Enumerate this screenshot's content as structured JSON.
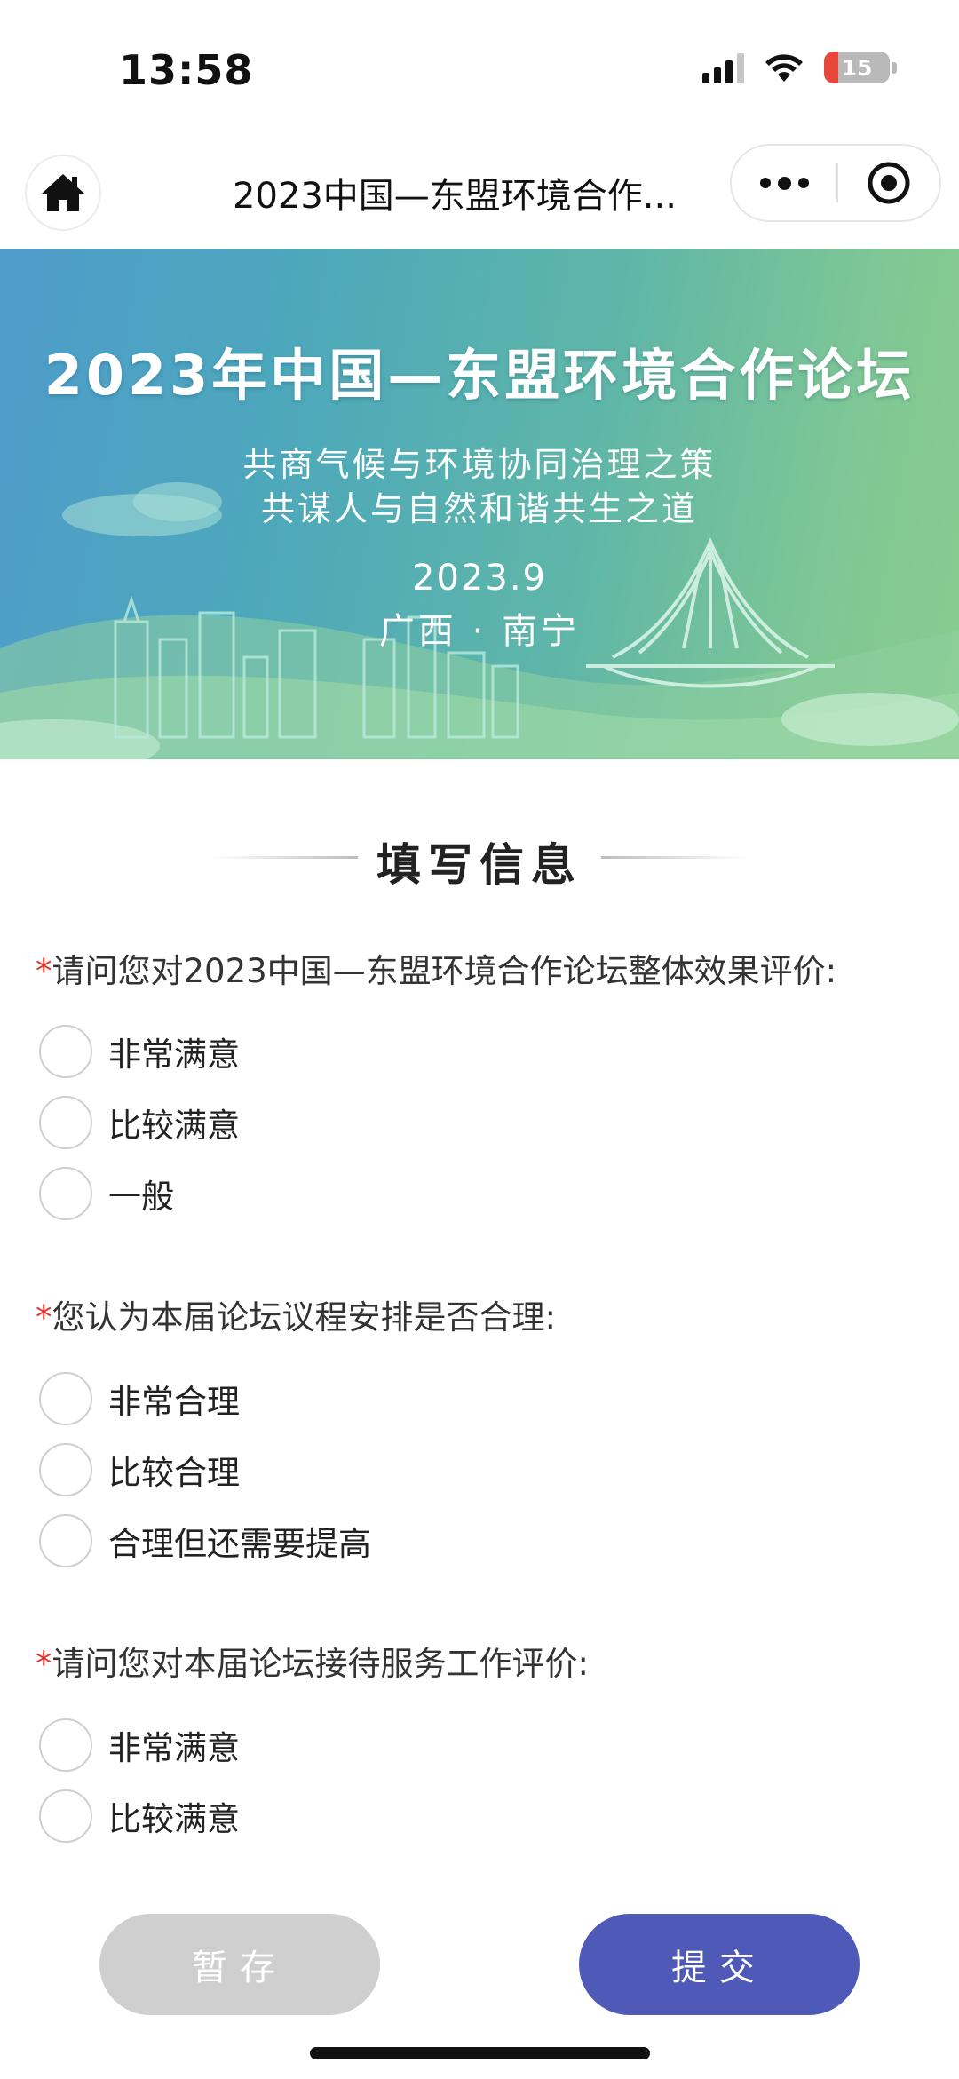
{
  "status_bar": {
    "time": "13:58",
    "battery_level": "15",
    "icons": [
      "signal-icon",
      "wifi-icon",
      "battery-charging-icon"
    ]
  },
  "nav": {
    "title": "2023中国—东盟环境合作...",
    "icons": [
      "home-icon",
      "more-icon",
      "close-mini-program-icon"
    ]
  },
  "banner": {
    "title": "2023年中国—东盟环境合作论坛",
    "subtitle_line1": "共商气候与环境协同治理之策",
    "subtitle_line2": "共谋人与自然和谐共生之道",
    "date": "2023.9",
    "place": "广西 · 南宁"
  },
  "form": {
    "heading": "填写信息",
    "required_mark": "*",
    "questions": [
      {
        "label": "请问您对2023中国—东盟环境合作论坛整体效果评价:",
        "options": [
          "非常满意",
          "比较满意",
          "一般"
        ]
      },
      {
        "label": "您认为本届论坛议程安排是否合理:",
        "options": [
          "非常合理",
          "比较合理",
          "合理但还需要提高"
        ]
      },
      {
        "label": "请问您对本届论坛接待服务工作评价:",
        "options": [
          "非常满意",
          "比较满意"
        ]
      }
    ]
  },
  "actions": {
    "save_label": "暂存",
    "submit_label": "提交"
  },
  "colors": {
    "accent": "#4f5ab8",
    "required": "#e2352b",
    "disabled_button": "#cfcfcf"
  }
}
